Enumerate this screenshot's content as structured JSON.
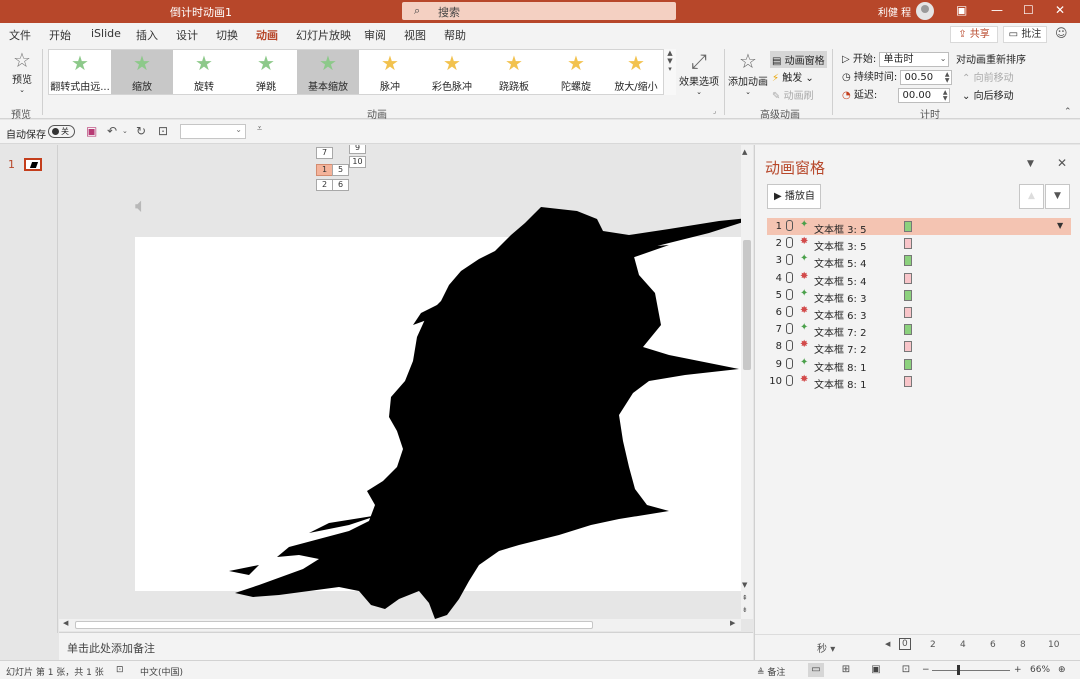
{
  "window": {
    "title": "倒计时动画1",
    "search_placeholder": "搜索",
    "user_name": "利健 程",
    "share_label": "共享",
    "comment_label": "批注"
  },
  "tabs": [
    "文件",
    "开始",
    "iSlide",
    "插入",
    "设计",
    "切换",
    "动画",
    "幻灯片放映",
    "审阅",
    "视图",
    "帮助"
  ],
  "active_tab": "动画",
  "ribbon": {
    "preview_label": "预览",
    "preview_group": "预览",
    "animation_group": "动画",
    "gallery": [
      {
        "label": "翻转式由远...",
        "kind": "green"
      },
      {
        "label": "缩放",
        "kind": "green"
      },
      {
        "label": "旋转",
        "kind": "green"
      },
      {
        "label": "弹跳",
        "kind": "green"
      },
      {
        "label": "基本缩放",
        "kind": "green"
      },
      {
        "label": "脉冲",
        "kind": "gold"
      },
      {
        "label": "彩色脉冲",
        "kind": "gold"
      },
      {
        "label": "跷跷板",
        "kind": "gold"
      },
      {
        "label": "陀螺旋",
        "kind": "gold"
      },
      {
        "label": "放大/缩小",
        "kind": "gold"
      }
    ],
    "effect_options": "效果选项",
    "add_animation": "添加动画",
    "animation_pane": "动画窗格",
    "trigger": "触发",
    "animation_painter": "动画刷",
    "advanced_group": "高级动画",
    "start_label": "开始:",
    "start_value": "单击时",
    "duration_label": "持续时间:",
    "duration_value": "00.50",
    "delay_label": "延迟:",
    "delay_value": "00.00",
    "reorder_label": "对动画重新排序",
    "move_earlier": "向前移动",
    "move_later": "向后移动",
    "timing_group": "计时"
  },
  "qat": {
    "autosave_label": "自动保存",
    "autosave_state": "关"
  },
  "slide_panel": {
    "slide_number": "1"
  },
  "canvas": {
    "animation_tags": [
      "7",
      "9",
      "10",
      "1",
      "5",
      "2",
      "6"
    ]
  },
  "animation_pane": {
    "title": "动画窗格",
    "play_label": "播放自",
    "items": [
      {
        "idx": "1",
        "name": "文本框 3: 5",
        "type": "enter"
      },
      {
        "idx": "2",
        "name": "文本框 3: 5",
        "type": "exit"
      },
      {
        "idx": "3",
        "name": "文本框 5: 4",
        "type": "enter"
      },
      {
        "idx": "4",
        "name": "文本框 5: 4",
        "type": "exit"
      },
      {
        "idx": "5",
        "name": "文本框 6: 3",
        "type": "enter"
      },
      {
        "idx": "6",
        "name": "文本框 6: 3",
        "type": "exit"
      },
      {
        "idx": "7",
        "name": "文本框 7: 2",
        "type": "enter"
      },
      {
        "idx": "8",
        "name": "文本框 7: 2",
        "type": "exit"
      },
      {
        "idx": "9",
        "name": "文本框 8: 1",
        "type": "enter"
      },
      {
        "idx": "10",
        "name": "文本框 8: 1",
        "type": "exit"
      }
    ],
    "timeline_unit": "秒",
    "timeline_ticks": [
      "0",
      "2",
      "4",
      "6",
      "8",
      "10"
    ]
  },
  "notes": {
    "placeholder": "单击此处添加备注"
  },
  "status": {
    "slide_info": "幻灯片 第 1 张，共 1 张",
    "language": "中文(中国)",
    "notes_label": "备注",
    "zoom": "66%"
  },
  "colors": {
    "accent": "#b7472a",
    "enter_green": "#8cd17d",
    "exit_pink": "#f8c5c9",
    "selected_row": "#f4c4b2"
  }
}
